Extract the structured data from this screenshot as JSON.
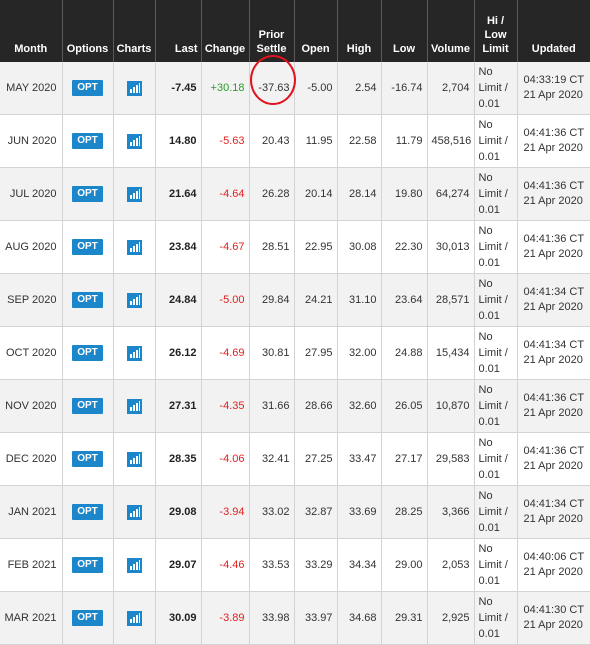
{
  "headers": {
    "month": "Month",
    "options": "Options",
    "charts": "Charts",
    "last": "Last",
    "change": "Change",
    "prior_settle_1": "Prior",
    "prior_settle_2": "Settle",
    "open": "Open",
    "high": "High",
    "low": "Low",
    "volume": "Volume",
    "hilo_1": "Hi /",
    "hilo_2": "Low",
    "hilo_3": "Limit",
    "updated": "Updated"
  },
  "opt_label": "OPT",
  "colors": {
    "header_bg": "#262626",
    "opt_button": "#1b86c9",
    "positive": "#2e9b2e",
    "negative": "#e02020",
    "annotation_circle": "#e0141e"
  },
  "icons": {
    "charts": "bar-chart-icon"
  },
  "rows": [
    {
      "month": "MAY 2020",
      "last": "-7.45",
      "change": "+30.18",
      "change_sign": "pos",
      "prior_settle": "-37.63",
      "open": "-5.00",
      "high": "2.54",
      "low": "-16.74",
      "volume": "2,704",
      "limit_1": "No",
      "limit_2": "Limit /",
      "limit_3": "0.01",
      "updated_time": "04:33:19 CT",
      "updated_date": "21 Apr 2020"
    },
    {
      "month": "JUN 2020",
      "last": "14.80",
      "change": "-5.63",
      "change_sign": "neg",
      "prior_settle": "20.43",
      "open": "11.95",
      "high": "22.58",
      "low": "11.79",
      "volume": "458,516",
      "limit_1": "No",
      "limit_2": "Limit /",
      "limit_3": "0.01",
      "updated_time": "04:41:36 CT",
      "updated_date": "21 Apr 2020"
    },
    {
      "month": "JUL 2020",
      "last": "21.64",
      "change": "-4.64",
      "change_sign": "neg",
      "prior_settle": "26.28",
      "open": "20.14",
      "high": "28.14",
      "low": "19.80",
      "volume": "64,274",
      "limit_1": "No",
      "limit_2": "Limit /",
      "limit_3": "0.01",
      "updated_time": "04:41:36 CT",
      "updated_date": "21 Apr 2020"
    },
    {
      "month": "AUG 2020",
      "last": "23.84",
      "change": "-4.67",
      "change_sign": "neg",
      "prior_settle": "28.51",
      "open": "22.95",
      "high": "30.08",
      "low": "22.30",
      "volume": "30,013",
      "limit_1": "No",
      "limit_2": "Limit /",
      "limit_3": "0.01",
      "updated_time": "04:41:36 CT",
      "updated_date": "21 Apr 2020"
    },
    {
      "month": "SEP 2020",
      "last": "24.84",
      "change": "-5.00",
      "change_sign": "neg",
      "prior_settle": "29.84",
      "open": "24.21",
      "high": "31.10",
      "low": "23.64",
      "volume": "28,571",
      "limit_1": "No",
      "limit_2": "Limit /",
      "limit_3": "0.01",
      "updated_time": "04:41:34 CT",
      "updated_date": "21 Apr 2020"
    },
    {
      "month": "OCT 2020",
      "last": "26.12",
      "change": "-4.69",
      "change_sign": "neg",
      "prior_settle": "30.81",
      "open": "27.95",
      "high": "32.00",
      "low": "24.88",
      "volume": "15,434",
      "limit_1": "No",
      "limit_2": "Limit /",
      "limit_3": "0.01",
      "updated_time": "04:41:34 CT",
      "updated_date": "21 Apr 2020"
    },
    {
      "month": "NOV 2020",
      "last": "27.31",
      "change": "-4.35",
      "change_sign": "neg",
      "prior_settle": "31.66",
      "open": "28.66",
      "high": "32.60",
      "low": "26.05",
      "volume": "10,870",
      "limit_1": "No",
      "limit_2": "Limit /",
      "limit_3": "0.01",
      "updated_time": "04:41:36 CT",
      "updated_date": "21 Apr 2020"
    },
    {
      "month": "DEC 2020",
      "last": "28.35",
      "change": "-4.06",
      "change_sign": "neg",
      "prior_settle": "32.41",
      "open": "27.25",
      "high": "33.47",
      "low": "27.17",
      "volume": "29,583",
      "limit_1": "No",
      "limit_2": "Limit /",
      "limit_3": "0.01",
      "updated_time": "04:41:36 CT",
      "updated_date": "21 Apr 2020"
    },
    {
      "month": "JAN 2021",
      "last": "29.08",
      "change": "-3.94",
      "change_sign": "neg",
      "prior_settle": "33.02",
      "open": "32.87",
      "high": "33.69",
      "low": "28.25",
      "volume": "3,366",
      "limit_1": "No",
      "limit_2": "Limit /",
      "limit_3": "0.01",
      "updated_time": "04:41:34 CT",
      "updated_date": "21 Apr 2020"
    },
    {
      "month": "FEB 2021",
      "last": "29.07",
      "change": "-4.46",
      "change_sign": "neg",
      "prior_settle": "33.53",
      "open": "33.29",
      "high": "34.34",
      "low": "29.00",
      "volume": "2,053",
      "limit_1": "No",
      "limit_2": "Limit /",
      "limit_3": "0.01",
      "updated_time": "04:40:06 CT",
      "updated_date": "21 Apr 2020"
    },
    {
      "month": "MAR 2021",
      "last": "30.09",
      "change": "-3.89",
      "change_sign": "neg",
      "prior_settle": "33.98",
      "open": "33.97",
      "high": "34.68",
      "low": "29.31",
      "volume": "2,925",
      "limit_1": "No",
      "limit_2": "Limit /",
      "limit_3": "0.01",
      "updated_time": "04:41:30 CT",
      "updated_date": "21 Apr 2020"
    }
  ]
}
